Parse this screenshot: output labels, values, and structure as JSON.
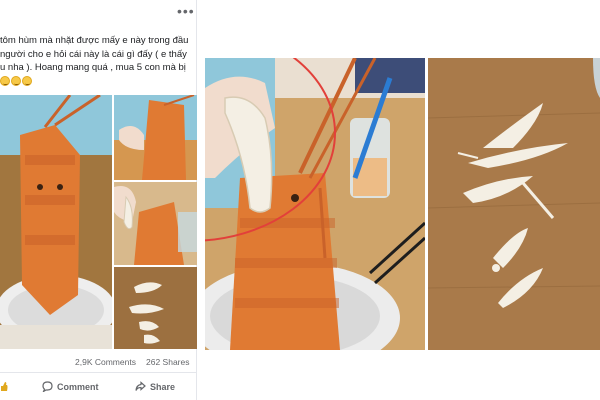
{
  "post": {
    "text_lines": [
      "tôm hùm mà nhặt được mấy e này trong đầu",
      "người cho e hỏi cái này là cái gì đấy ( e thấy",
      "u nha ). Hoang mang quá , mua 5 con mà bị"
    ],
    "emojis": [
      "confused-face",
      "confused-face",
      "confused-face"
    ],
    "comments_count": "2,9K Comments",
    "shares_count": "262 Shares",
    "actions": {
      "comment_label": "Comment",
      "share_label": "Share"
    }
  },
  "colors": {
    "facebook_text": "#1c1e21",
    "facebook_meta": "#65676b",
    "annotation_red": "#e2403a",
    "lobster_orange": "#e07a33",
    "parasite_white": "#f4efe4",
    "wood_table": "#a97a4a"
  },
  "images": {
    "grid_main": "lobster-in-bowl-photo",
    "grid_top_right": "lobster-head-photo",
    "grid_middle_right": "hand-holding-parasite-photo",
    "grid_bottom_right": "parasites-on-table-photo",
    "large_left": "hand-holding-parasite-over-lobster-photo",
    "large_right": "white-parasites-on-wooden-table-photo"
  }
}
